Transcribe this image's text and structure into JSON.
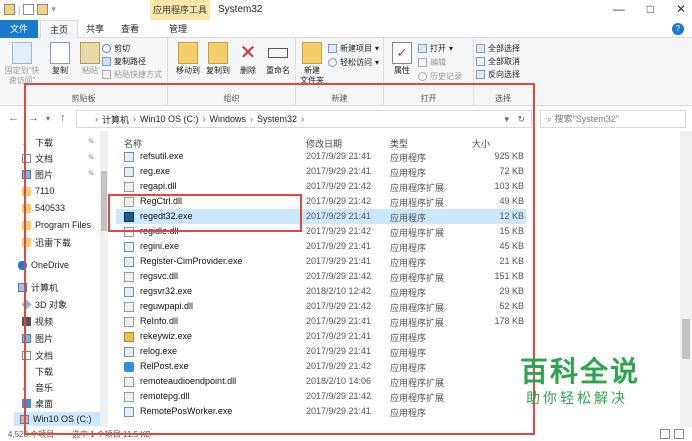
{
  "window": {
    "title": "System32",
    "context_tab": "应用程序工具",
    "controls": [
      "—",
      "□",
      "✕"
    ]
  },
  "tabs": {
    "file": "文件",
    "home": "主页",
    "share": "共享",
    "view": "查看",
    "manage": "管理"
  },
  "ribbon": {
    "clipboard": {
      "label": "剪贴板",
      "pin": "固定到\"快速访问\"",
      "copy": "复制",
      "paste": "粘贴",
      "cut": "剪切",
      "copy_path": "复制路径",
      "paste_shortcut": "粘贴快捷方式"
    },
    "organize": {
      "label": "组织",
      "move_to": "移动到",
      "copy_to": "复制到",
      "delete": "删除",
      "rename": "重命名"
    },
    "new": {
      "label": "新建",
      "new_folder": "新建\n文件夹",
      "new_item": "新建项目",
      "easy_access": "轻松访问"
    },
    "open": {
      "label": "打开",
      "properties": "属性",
      "open": "打开",
      "edit": "编辑",
      "history": "历史记录"
    },
    "select": {
      "label": "选择",
      "select_all": "全部选择",
      "select_none": "全部取消",
      "invert": "反向选择"
    }
  },
  "address": {
    "crumbs": [
      "计算机",
      "Win10 OS (C:)",
      "Windows",
      "System32"
    ],
    "search_placeholder": "搜索\"System32\""
  },
  "nav_pane": {
    "items": [
      {
        "label": "下载",
        "icon": "download-icon"
      },
      {
        "label": "文档",
        "icon": "document-icon"
      },
      {
        "label": "图片",
        "icon": "picture-icon"
      },
      {
        "label": "7110",
        "icon": "folder-icon"
      },
      {
        "label": "540533",
        "icon": "folder-icon"
      },
      {
        "label": "Program Files",
        "icon": "folder-icon"
      },
      {
        "label": "迅雷下载",
        "icon": "folder-icon"
      },
      {
        "label": "OneDrive",
        "icon": "cloud-icon"
      },
      {
        "label": "计算机",
        "icon": "computer-icon"
      },
      {
        "label": "3D 对象",
        "icon": "cube-icon"
      },
      {
        "label": "视频",
        "icon": "video-icon"
      },
      {
        "label": "图片",
        "icon": "picture-icon"
      },
      {
        "label": "文档",
        "icon": "document-icon"
      },
      {
        "label": "下载",
        "icon": "download-icon"
      },
      {
        "label": "音乐",
        "icon": "music-icon"
      },
      {
        "label": "桌面",
        "icon": "desktop-icon"
      },
      {
        "label": "Win10 OS (C:)",
        "icon": "drive-icon"
      }
    ]
  },
  "columns": {
    "name": "名称",
    "date": "修改日期",
    "type": "类型",
    "size": "大小"
  },
  "files": [
    {
      "name": "refsutil.exe",
      "date": "2017/9/29 21:41",
      "type": "应用程序",
      "size": "925 KB",
      "icon": "exe"
    },
    {
      "name": "reg.exe",
      "date": "2017/9/29 21:41",
      "type": "应用程序",
      "size": "72 KB",
      "icon": "exe"
    },
    {
      "name": "regapi.dll",
      "date": "2017/9/29 21:42",
      "type": "应用程序扩展",
      "size": "103 KB",
      "icon": "dll"
    },
    {
      "name": "RegCtrl.dll",
      "date": "2017/9/29 21:42",
      "type": "应用程序扩展",
      "size": "49 KB",
      "icon": "dll"
    },
    {
      "name": "regedt32.exe",
      "date": "2017/9/29 21:41",
      "type": "应用程序",
      "size": "12 KB",
      "icon": "regedit",
      "selected": true
    },
    {
      "name": "regidle.dll",
      "date": "2017/9/29 21:42",
      "type": "应用程序扩展",
      "size": "15 KB",
      "icon": "dll"
    },
    {
      "name": "regini.exe",
      "date": "2017/9/29 21:41",
      "type": "应用程序",
      "size": "45 KB",
      "icon": "exe"
    },
    {
      "name": "Register-CimProvider.exe",
      "date": "2017/9/29 21:41",
      "type": "应用程序",
      "size": "21 KB",
      "icon": "exe"
    },
    {
      "name": "regsvc.dll",
      "date": "2017/9/29 21:42",
      "type": "应用程序扩展",
      "size": "151 KB",
      "icon": "dll"
    },
    {
      "name": "regsvr32.exe",
      "date": "2018/2/10 12:42",
      "type": "应用程序",
      "size": "29 KB",
      "icon": "exe"
    },
    {
      "name": "reguwpapi.dll",
      "date": "2017/9/29 21:42",
      "type": "应用程序扩展",
      "size": "52 KB",
      "icon": "dll"
    },
    {
      "name": "ReInfo.dll",
      "date": "2017/9/29 21:41",
      "type": "应用程序扩展",
      "size": "178 KB",
      "icon": "dll"
    },
    {
      "name": "rekeywiz.exe",
      "date": "2017/9/29 21:41",
      "type": "应用程序",
      "size": "",
      "icon": "wizard"
    },
    {
      "name": "relog.exe",
      "date": "2017/9/29 21:41",
      "type": "应用程序",
      "size": "",
      "icon": "exe"
    },
    {
      "name": "RelPost.exe",
      "date": "2017/9/29 21:42",
      "type": "应用程序",
      "size": "",
      "icon": "relpost"
    },
    {
      "name": "remoteaudioendpoint.dll",
      "date": "2018/2/10 14:06",
      "type": "应用程序扩展",
      "size": "",
      "icon": "dll"
    },
    {
      "name": "remotepg.dll",
      "date": "2017/9/29 21:42",
      "type": "应用程序扩展",
      "size": "",
      "icon": "dll"
    },
    {
      "name": "RemotePosWorker.exe",
      "date": "2017/9/29 21:41",
      "type": "应用程序",
      "size": "",
      "icon": "exe"
    }
  ],
  "status": {
    "count": "4,528 个项目",
    "selected": "选中 1 个项目  11.5 KB"
  },
  "watermark": {
    "main": "百科全说",
    "sub": "助你轻松解决"
  },
  "colors": {
    "accent": "#1979ca",
    "selection": "#cce8ff",
    "highlight_box": "#e0483e",
    "watermark": "#2ea44f"
  }
}
